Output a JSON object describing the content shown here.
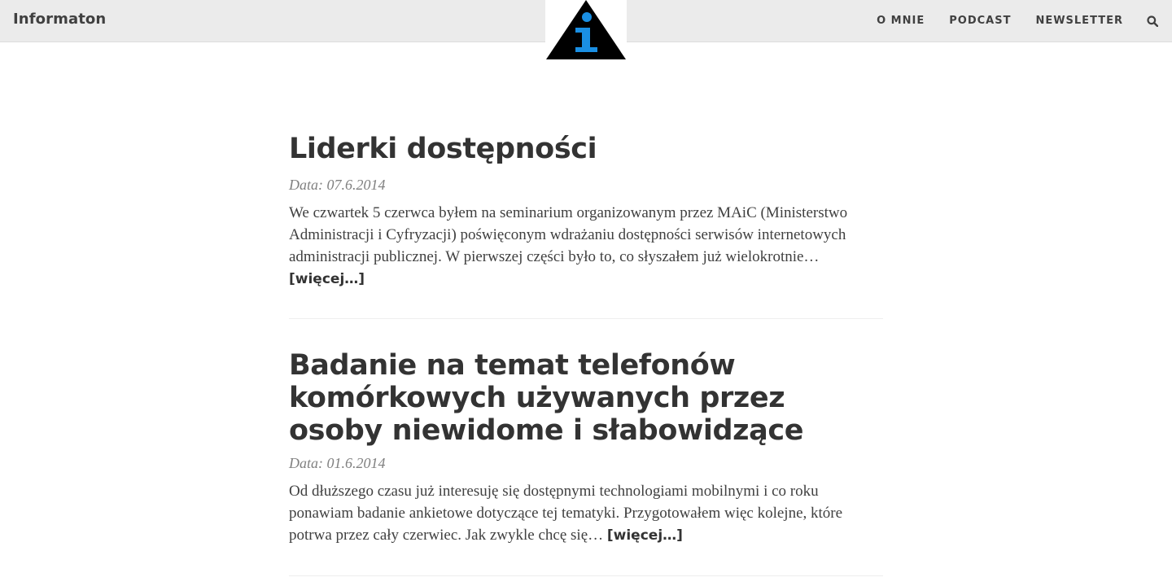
{
  "site": {
    "brand": "Informaton",
    "logo": {
      "icon": "info-triangle-logo",
      "colors": {
        "triangle": "#000000",
        "letter": "#1a8fe3"
      }
    }
  },
  "nav": {
    "items": [
      {
        "label": "O MNIE"
      },
      {
        "label": "PODCAST"
      },
      {
        "label": "NEWSLETTER"
      }
    ],
    "search_icon": "search-icon"
  },
  "posts": [
    {
      "title": "Liderki dostępności",
      "date": "Data: 07.6.2014",
      "excerpt": "We czwartek 5 czerwca byłem na seminarium organizowanym przez MAiC (Ministerstwo Administracji i Cyfryzacji) poświęconym wdrażaniu dostępności serwisów internetowych administracji publicznej. W pierwszej części było to, co słyszałem już wielokrotnie…",
      "more": "[więcej…]"
    },
    {
      "title": "Badanie na temat telefonów komórkowych używanych przez osoby niewidome i słabowidzące",
      "date": "Data: 01.6.2014",
      "excerpt": "Od dłuższego czasu już interesuję się dostępnymi technologiami mobilnymi i co roku ponawiam badanie ankietowe dotyczące tej tematyki. Przygotowałem więc kolejne, które potrwa przez cały czerwiec. Jak zwykle chcę się…",
      "more": "[więcej…]"
    }
  ]
}
